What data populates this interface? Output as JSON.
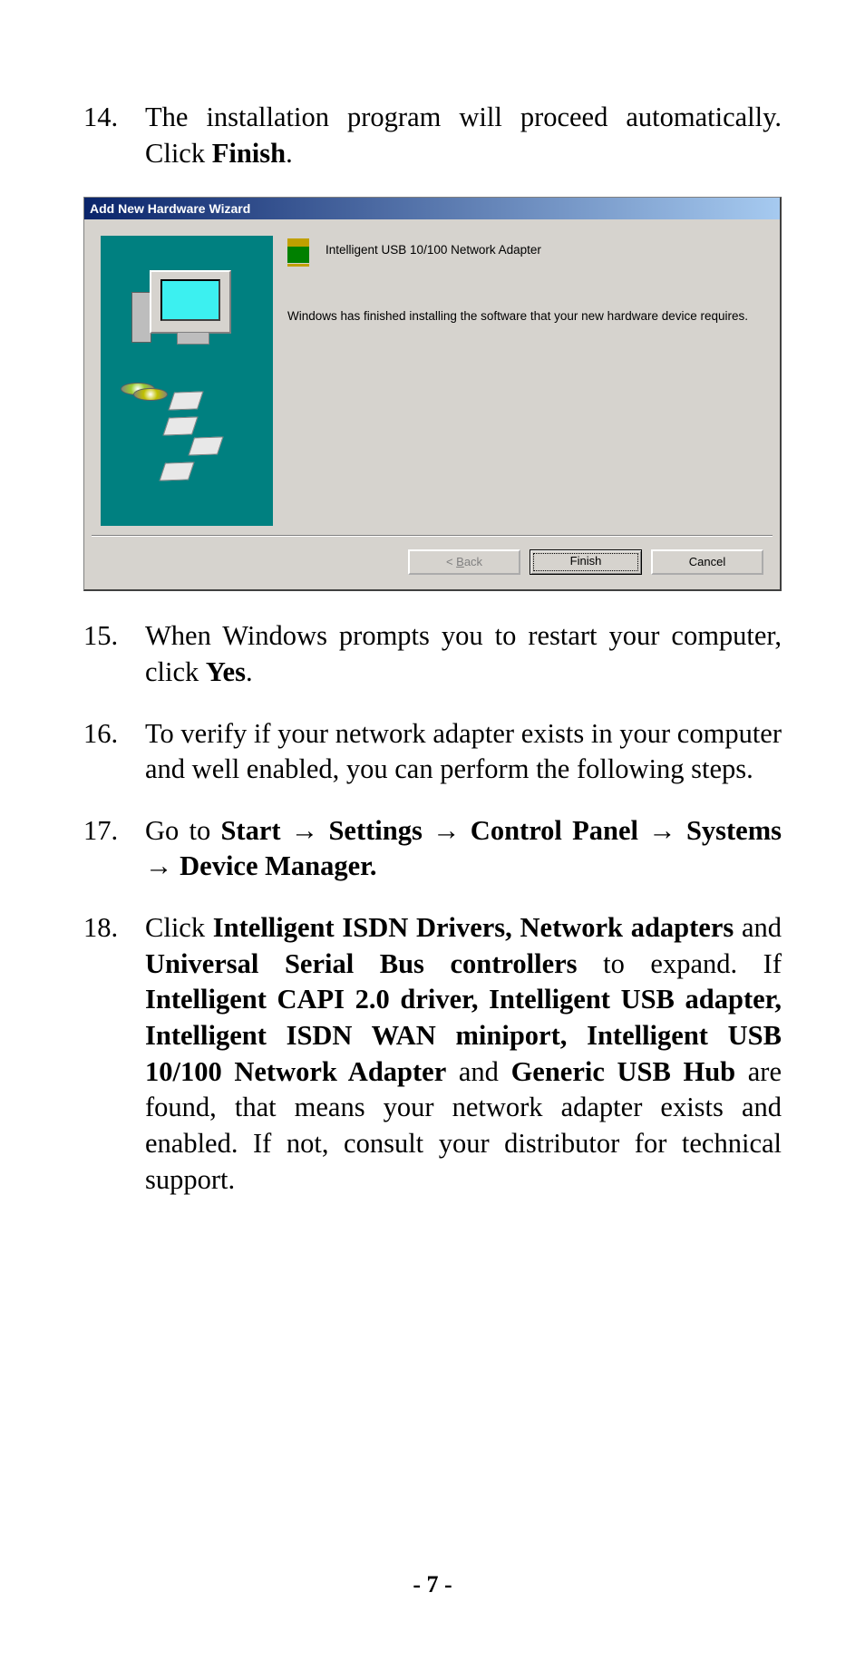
{
  "steps": {
    "s14": {
      "num": "14.",
      "text_a": "The installation program will proceed automatically. Click ",
      "text_b": "Finish",
      "text_c": "."
    },
    "s15": {
      "num": "15.",
      "text_a": "When Windows prompts you to restart your computer, click ",
      "text_b": "Yes",
      "text_c": "."
    },
    "s16": {
      "num": "16.",
      "text": "To verify if your network adapter exists in your computer and well enabled, you can perform the following steps."
    },
    "s17": {
      "num": "17.",
      "lead": "Go to ",
      "b1": "Start ",
      "a1": "→",
      "b2": " Settings ",
      "a2": "→",
      "b3": " Control Panel ",
      "a3": "→",
      "b4": " Systems ",
      "a4": "→",
      "b5": " Device Manager."
    },
    "s18": {
      "num": "18.",
      "t1": "Click ",
      "b1": "Intelligent ISDN Drivers, Network adapters",
      "t2": " and ",
      "b2": "Universal Serial Bus controllers",
      "t3": " to expand. If ",
      "b3": "Intelligent CAPI 2.0 driver, Intelligent USB adapter, Intelligent ISDN WAN miniport, Intelligent USB 10/100 Network Adapter",
      "t4": " and ",
      "b4": "Generic USB Hub",
      "t5": " are found, that means your network adapter exists and enabled.  If not, consult your distributor for technical support."
    }
  },
  "wizard": {
    "title": "Add New Hardware Wizard",
    "device_name": "Intelligent USB 10/100 Network Adapter",
    "message": "Windows has finished installing the software that your new hardware device requires.",
    "btn_back_prefix": "< ",
    "btn_back_letter": "B",
    "btn_back_rest": "ack",
    "btn_finish": "Finish",
    "btn_cancel": "Cancel"
  },
  "page_number": "- 7 -"
}
